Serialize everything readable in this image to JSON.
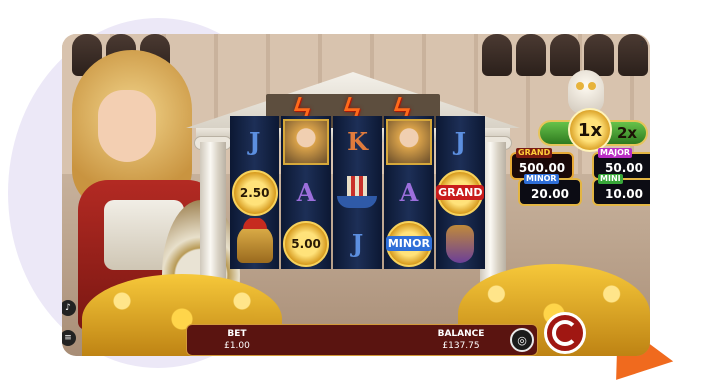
{
  "reels": [
    [
      "J",
      "portrait",
      "K",
      "portrait",
      "J"
    ],
    [
      "2.50",
      "A",
      "ship",
      "A",
      "GRAND"
    ],
    [
      "helmet",
      "5.00",
      "J",
      "MINOR",
      "vase"
    ]
  ],
  "symbols": {
    "coin_250": "2.50",
    "coin_500": "5.00",
    "grand": "GRAND",
    "minor": "MINOR",
    "letter_j": "J",
    "letter_k": "K",
    "letter_a": "A"
  },
  "multiplier": {
    "main": "1x",
    "next": "2x"
  },
  "jackpots": {
    "grand": {
      "label": "GRAND",
      "value": "500.00"
    },
    "major": {
      "label": "MAJOR",
      "value": "50.00"
    },
    "minor": {
      "label": "MINOR",
      "value": "20.00"
    },
    "mini": {
      "label": "MINI",
      "value": "10.00"
    }
  },
  "bottom_bar": {
    "bet_label": "BET",
    "bet_value": "£1.00",
    "balance_label": "BALANCE",
    "balance_value": "£137.75"
  },
  "corner_text": "?",
  "colors": {
    "spin_button": "#a01712",
    "bottom_bar": "#5a1410",
    "grand_accent": "#c91c1c",
    "minor_accent": "#2f6fd8",
    "mini_accent": "#39a83a",
    "major_accent": "#b92cc4",
    "bolt": "#ff6a1a"
  },
  "icons": [
    "lightning-bolt-icon",
    "owl-icon",
    "sound-icon",
    "menu-icon",
    "coin-stack-icon",
    "spin-icon"
  ]
}
